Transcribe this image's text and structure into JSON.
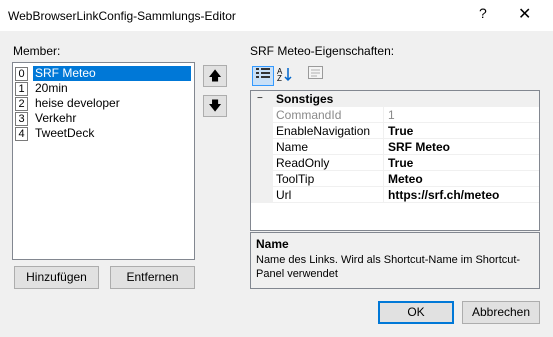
{
  "window": {
    "title": "WebBrowserLinkConfig-Sammlungs-Editor",
    "help": "?",
    "close": "✕"
  },
  "members": {
    "label": "Member:",
    "items": [
      {
        "index": "0",
        "label": "SRF Meteo",
        "selected": true
      },
      {
        "index": "1",
        "label": "20min"
      },
      {
        "index": "2",
        "label": "heise developer"
      },
      {
        "index": "3",
        "label": "Verkehr"
      },
      {
        "index": "4",
        "label": "TweetDeck"
      }
    ],
    "move_up": "🡅",
    "move_down": "🡇",
    "add_label": "Hinzufügen",
    "remove_label": "Entfernen"
  },
  "properties": {
    "label": "SRF Meteo-Eigenschaften:",
    "toolbar": {
      "categorized_icon": "categorized-icon",
      "alphabetical_icon": "alphabetical-icon",
      "pages_icon": "property-pages-icon"
    },
    "category": {
      "toggle": "−",
      "name": "Sonstiges"
    },
    "rows": [
      {
        "name": "CommandId",
        "value": "1",
        "readonly": true
      },
      {
        "name": "EnableNavigation",
        "value": "True"
      },
      {
        "name": "Name",
        "value": "SRF Meteo"
      },
      {
        "name": "ReadOnly",
        "value": "True"
      },
      {
        "name": "ToolTip",
        "value": "Meteo"
      },
      {
        "name": "Url",
        "value": "https://srf.ch/meteo"
      }
    ],
    "description": {
      "name": "Name",
      "text": "Name des Links. Wird als Shortcut-Name im Shortcut-Panel verwendet"
    }
  },
  "buttons": {
    "ok": "OK",
    "cancel": "Abbrechen"
  },
  "colors": {
    "selection": "#0078d7",
    "dialog_bg": "#f0f0f0"
  }
}
